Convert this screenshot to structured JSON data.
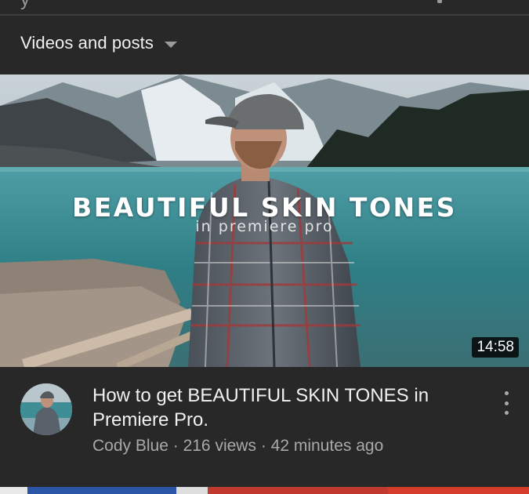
{
  "filter": {
    "label": "Videos and posts",
    "icon": "dropdown-caret-icon"
  },
  "video": {
    "thumbnail_title": "BEAUTIFUL SKIN TONES",
    "thumbnail_subtitle": "in premiere pro",
    "duration": "14:58",
    "title": "How to get BEAUTIFUL SKIN TONES in Premiere Pro.",
    "channel": "Cody Blue",
    "separator": "·",
    "views": "216 views",
    "age": "42 minutes ago",
    "menu_icon": "more-vert-icon"
  },
  "colors": {
    "background": "#282828",
    "primary_text": "#f1f1f1",
    "secondary_text": "#a9a9a9",
    "duration_badge": "#000000"
  }
}
